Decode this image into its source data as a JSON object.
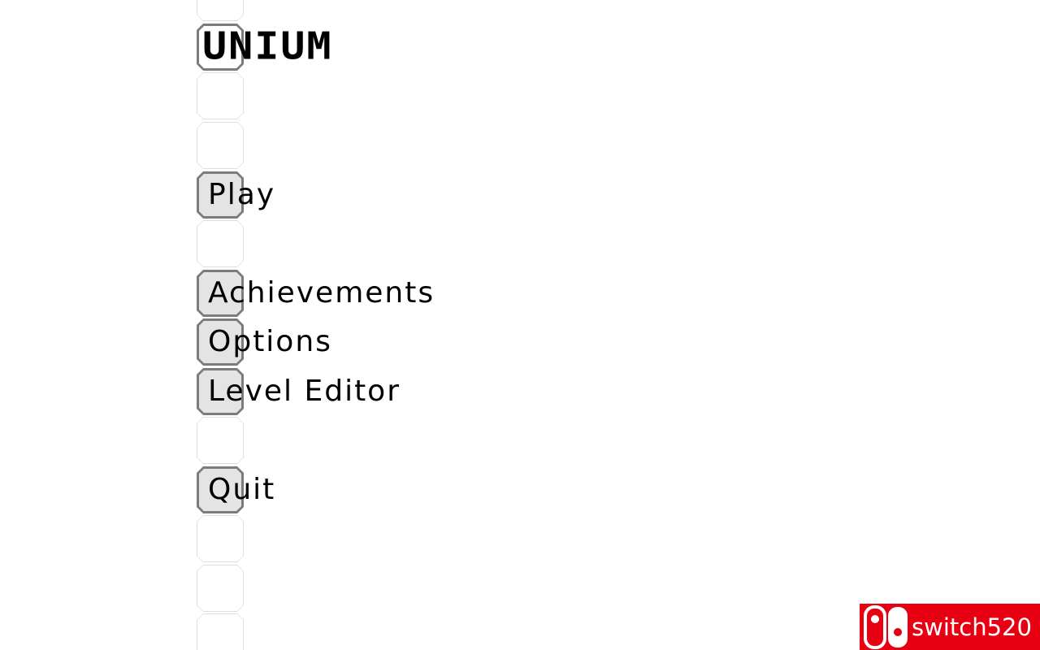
{
  "game": {
    "title": "UNIUM"
  },
  "menu": {
    "items": [
      {
        "id": "play",
        "label": "Play"
      },
      {
        "id": "achievements",
        "label": "Achievements"
      },
      {
        "id": "options",
        "label": "Options"
      },
      {
        "id": "level-editor",
        "label": "Level Editor"
      },
      {
        "id": "quit",
        "label": "Quit"
      }
    ]
  },
  "watermark": {
    "text": "switch520",
    "icon": "switch-console-icon",
    "color": "#e60012"
  },
  "colors": {
    "background": "#ffffff",
    "tile_border_active": "#7c7c7c",
    "tile_fill_active": "#e4e4e4",
    "tile_border_inactive": "#dedede",
    "text": "#000000"
  }
}
